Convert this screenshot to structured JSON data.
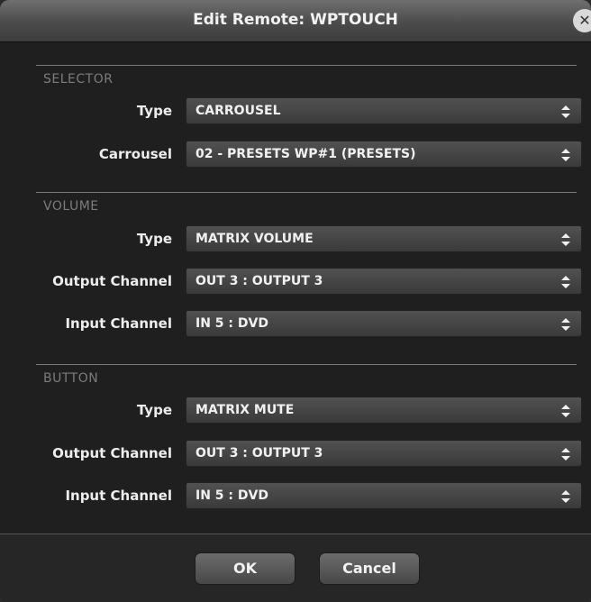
{
  "dialog": {
    "title": "Edit Remote: WPTOUCH",
    "close_glyph": "✕"
  },
  "sections": {
    "selector": {
      "label": "SELECTOR",
      "rows": [
        {
          "label": "Type",
          "value": "CARROUSEL"
        },
        {
          "label": "Carrousel",
          "value": "02 - PRESETS WP#1 (PRESETS)"
        }
      ]
    },
    "volume": {
      "label": "VOLUME",
      "rows": [
        {
          "label": "Type",
          "value": "MATRIX VOLUME"
        },
        {
          "label": "Output Channel",
          "value": "OUT 3 : OUTPUT 3"
        },
        {
          "label": "Input Channel",
          "value": "IN 5 : DVD"
        }
      ]
    },
    "button": {
      "label": "BUTTON",
      "rows": [
        {
          "label": "Type",
          "value": "MATRIX MUTE"
        },
        {
          "label": "Output Channel",
          "value": "OUT 3 : OUTPUT 3"
        },
        {
          "label": "Input Channel",
          "value": "IN 5 : DVD"
        }
      ]
    }
  },
  "footer": {
    "ok_label": "OK",
    "cancel_label": "Cancel"
  },
  "icons": {
    "close": "close-icon",
    "select_arrows": "updown-arrows-icon"
  },
  "colors": {
    "background": "#1f1f1f",
    "titlebar": "#4b4b4b",
    "section_label": "#7c7c7c"
  }
}
